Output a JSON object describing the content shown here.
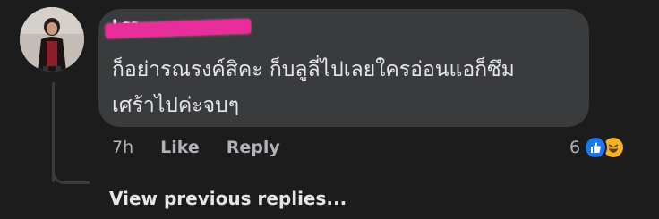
{
  "comment": {
    "author_name": "Lรร ... rur",
    "text_line1": "ก็อย่ารณรงค์สิคะ ก็บลูลี่ไปเลยใครอ่อนแอก็ซึม",
    "text_line2": "เศร้าไปค่ะจบๆ",
    "timestamp": "7h",
    "like_label": "Like",
    "reply_label": "Reply",
    "reaction_count": "6",
    "reactions": [
      "like-icon",
      "haha-icon"
    ]
  },
  "replies": {
    "view_previous_label": "View previous replies..."
  },
  "colors": {
    "background": "#1c1c1d",
    "bubble": "#3a3b3c",
    "text": "#e4e6eb",
    "secondary_text": "#b0b3b8",
    "like_blue": "#1877f2",
    "haha_yellow": "#f7b125",
    "redaction": "#e92d9a"
  }
}
